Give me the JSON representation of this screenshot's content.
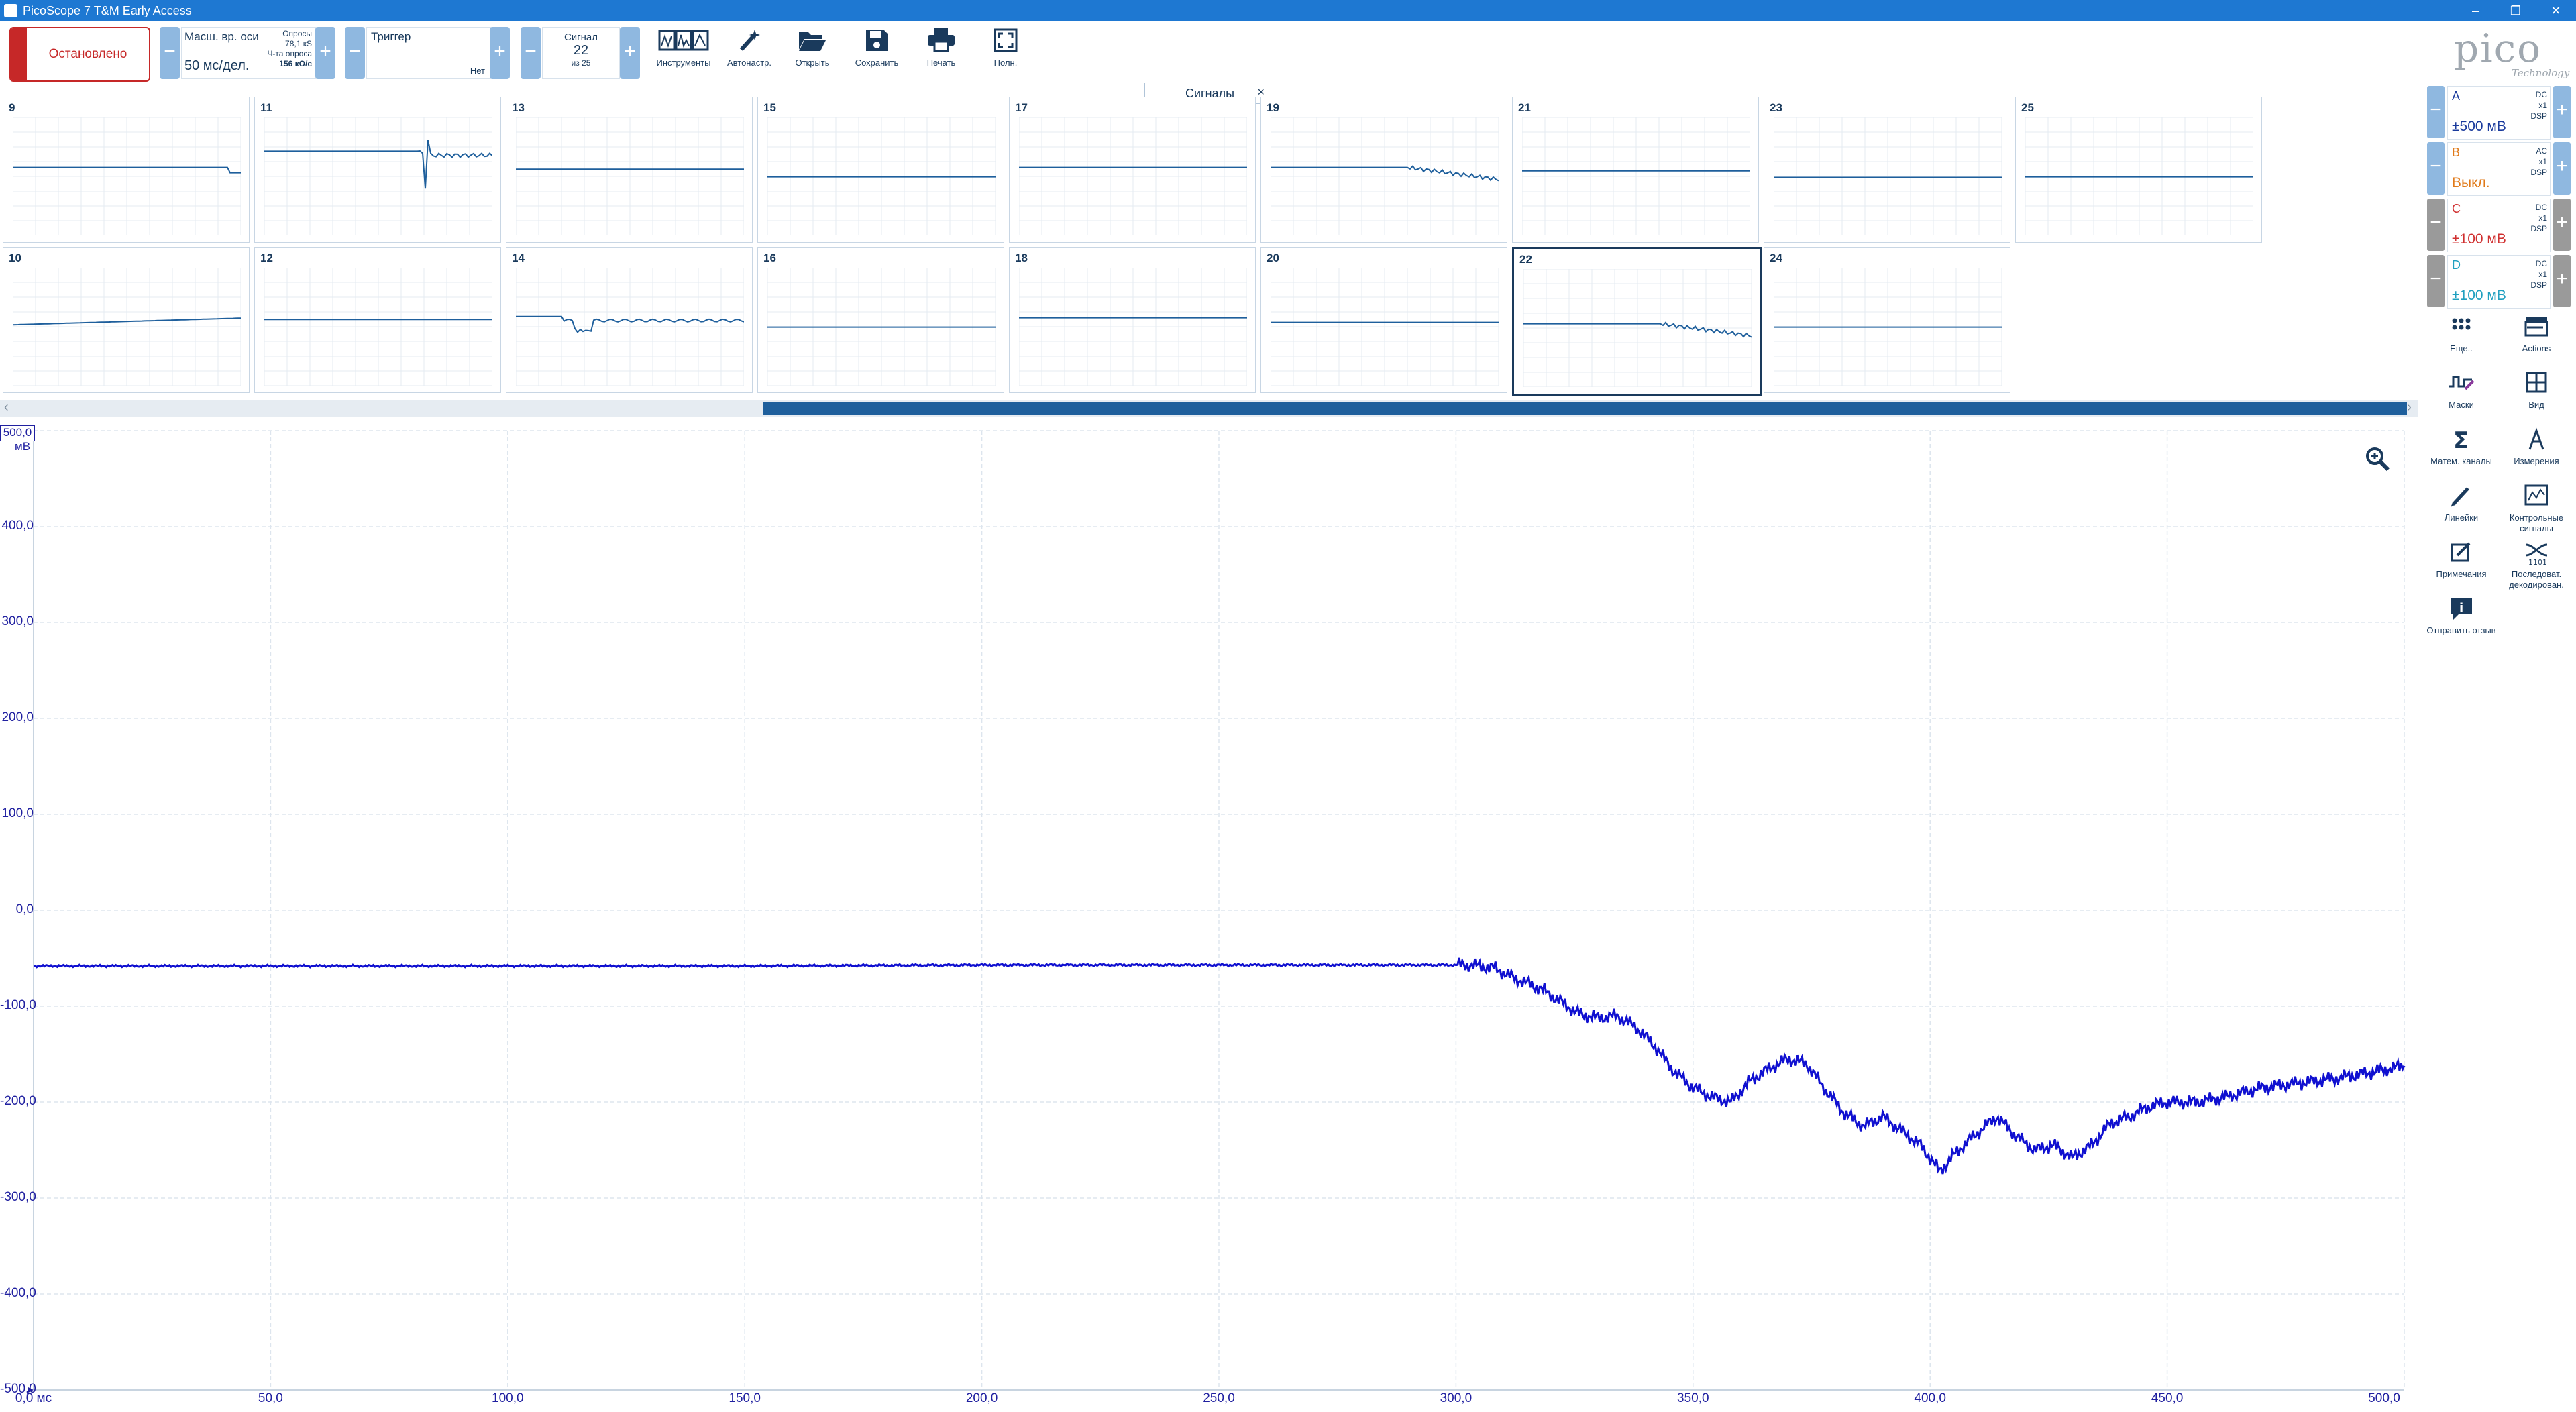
{
  "titlebar": {
    "title": "PicoScope 7 T&M Early Access",
    "minimize": "–",
    "maximize": "❐",
    "close": "✕"
  },
  "toolbar": {
    "stop_label": "Остановлено",
    "timebase": {
      "label": "Масш. вр. оси",
      "value": "50 мс/дел."
    },
    "samples": {
      "label1": "Опросы",
      "value1": "78,1 кS",
      "label2": "Ч-та опроса",
      "value2": "156 кО/с"
    },
    "trigger": {
      "label": "Триггер",
      "mode": "Нет"
    },
    "signal": {
      "label": "Сигнал",
      "current": "22",
      "of": "из 25"
    },
    "items": [
      {
        "label": "Инструменты",
        "icon": "instruments-icon"
      },
      {
        "label": "Автонастр.",
        "icon": "autoset-wand-icon"
      },
      {
        "label": "Открыть",
        "icon": "folder-open-icon"
      },
      {
        "label": "Сохранить",
        "icon": "save-disk-icon"
      },
      {
        "label": "Печать",
        "icon": "printer-icon"
      },
      {
        "label": "Полн.",
        "icon": "fullscreen-icon"
      }
    ],
    "logo_main": "pico",
    "logo_sub": "Technology"
  },
  "signals_panel": {
    "tab_label": "Сигналы",
    "close": "×",
    "thumbnails": [
      {
        "num": "9",
        "level": 0.62,
        "shape": "flat-drop-end",
        "selected": false
      },
      {
        "num": "11",
        "level": 0.55,
        "shape": "spike-mid",
        "selected": false
      },
      {
        "num": "13",
        "level": 0.65,
        "shape": "flat",
        "selected": false
      },
      {
        "num": "15",
        "level": 0.78,
        "shape": "flat",
        "selected": false
      },
      {
        "num": "17",
        "level": 0.62,
        "shape": "flat",
        "selected": false
      },
      {
        "num": "19",
        "level": 0.62,
        "shape": "droop-end",
        "selected": false
      },
      {
        "num": "21",
        "level": 0.68,
        "shape": "flat",
        "selected": false
      },
      {
        "num": "23",
        "level": 0.79,
        "shape": "flat",
        "selected": false
      },
      {
        "num": "25",
        "level": 0.78,
        "shape": "flat",
        "selected": false
      },
      {
        "num": "10",
        "level": 0.65,
        "shape": "rising",
        "selected": false
      },
      {
        "num": "12",
        "level": 0.65,
        "shape": "flat",
        "selected": false
      },
      {
        "num": "14",
        "level": 0.6,
        "shape": "spike-early",
        "selected": false
      },
      {
        "num": "16",
        "level": 0.78,
        "shape": "flat",
        "selected": false
      },
      {
        "num": "18",
        "level": 0.62,
        "shape": "flat",
        "selected": false
      },
      {
        "num": "20",
        "level": 0.7,
        "shape": "flat",
        "selected": false
      },
      {
        "num": "22",
        "level": 0.7,
        "shape": "droop-end",
        "selected": true
      },
      {
        "num": "24",
        "level": 0.78,
        "shape": "flat",
        "selected": false
      }
    ]
  },
  "chart_data": {
    "type": "line",
    "title": "",
    "xlabel": "",
    "ylabel": "мВ",
    "xlim": [
      0,
      500
    ],
    "ylim": [
      -500,
      500
    ],
    "x_ticks": [
      "0,0 мс",
      "50,0",
      "100,0",
      "150,0",
      "200,0",
      "250,0",
      "300,0",
      "350,0",
      "400,0",
      "450,0",
      "500,0"
    ],
    "y_ticks": [
      "500,0",
      "400,0",
      "300,0",
      "200,0",
      "100,0",
      "0,0",
      "-100,0",
      "-200,0",
      "-300,0",
      "-400,0",
      "-500,0"
    ],
    "grid": true,
    "series": [
      {
        "color": "#1010d0",
        "x": [
          0,
          50,
          100,
          150,
          200,
          250,
          300,
          303,
          308,
          312,
          318,
          322,
          326,
          330,
          334,
          338,
          342,
          346,
          350,
          354,
          358,
          362,
          366,
          370,
          374,
          378,
          382,
          386,
          390,
          394,
          398,
          402,
          406,
          410,
          414,
          418,
          422,
          426,
          430,
          434,
          438,
          442,
          446,
          450,
          456,
          462,
          470,
          478,
          486,
          494,
          500
        ],
        "values": [
          -58,
          -58,
          -58,
          -58,
          -57,
          -57,
          -57,
          -57,
          -60,
          -70,
          -82,
          -95,
          -108,
          -112,
          -110,
          -122,
          -142,
          -168,
          -185,
          -195,
          -200,
          -178,
          -165,
          -155,
          -160,
          -188,
          -212,
          -225,
          -215,
          -230,
          -245,
          -272,
          -250,
          -232,
          -215,
          -235,
          -250,
          -245,
          -258,
          -245,
          -222,
          -215,
          -205,
          -200,
          -200,
          -195,
          -185,
          -180,
          -175,
          -168,
          -162
        ]
      }
    ]
  },
  "side_panel": {
    "channels": [
      {
        "name": "A",
        "range": "±500 мВ",
        "coupling": "DC",
        "probe": "x1",
        "dsp": "DSP",
        "color": "#1a3a9c",
        "active": true
      },
      {
        "name": "B",
        "range": "Выкл.",
        "coupling": "AC",
        "probe": "x1",
        "dsp": "DSP",
        "color": "#e07a1a",
        "active": true
      },
      {
        "name": "C",
        "range": "±100 мВ",
        "coupling": "DC",
        "probe": "x1",
        "dsp": "DSP",
        "color": "#d03030",
        "active": false
      },
      {
        "name": "D",
        "range": "±100 мВ",
        "coupling": "DC",
        "probe": "x1",
        "dsp": "DSP",
        "color": "#20a0c0",
        "active": false
      }
    ],
    "tools": [
      {
        "label": "Еще..",
        "icon": "more-grid-icon"
      },
      {
        "label": "Actions",
        "icon": "actions-clapper-icon"
      },
      {
        "label": "Маски",
        "icon": "masks-icon"
      },
      {
        "label": "Вид",
        "icon": "view-grid-icon"
      },
      {
        "label": "Матем. каналы",
        "icon": "sigma-icon"
      },
      {
        "label": "Измерения",
        "icon": "measure-caliper-icon"
      },
      {
        "label": "Линейки",
        "icon": "ruler-pencil-icon"
      },
      {
        "label": "Контрольные сигналы",
        "icon": "reference-waveform-icon"
      },
      {
        "label": "Примечания",
        "icon": "notes-icon"
      },
      {
        "label": "Последоват. декодирован.",
        "icon": "serial-decode-icon"
      },
      {
        "label": "Отправить отзыв",
        "icon": "feedback-info-icon"
      }
    ]
  },
  "colors": {
    "accent": "#1e78d2",
    "stop": "#c62828",
    "trace": "#1010d0",
    "axis_text": "#2020a0"
  }
}
